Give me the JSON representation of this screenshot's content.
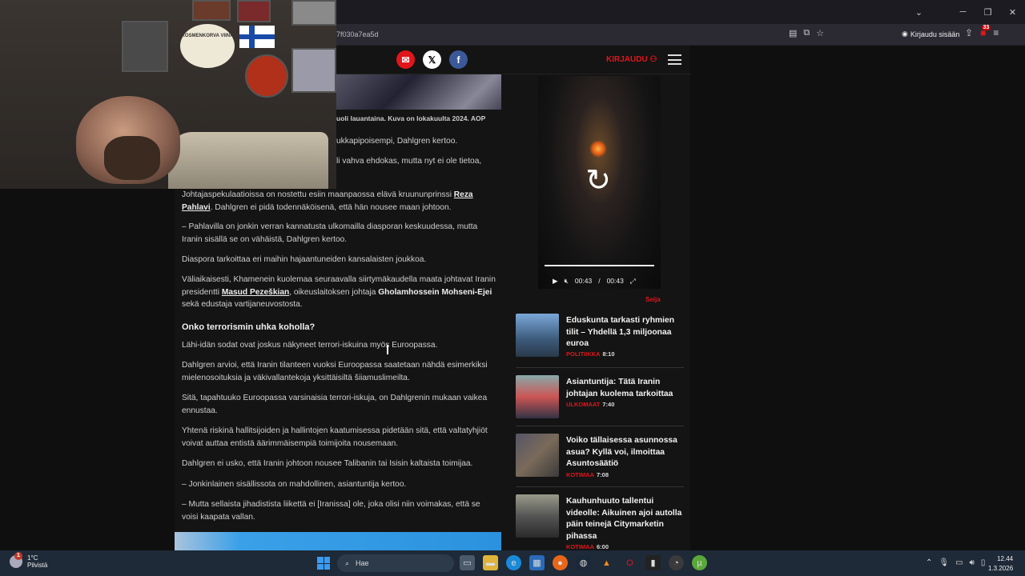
{
  "browser": {
    "url": "7f030a7ea5d",
    "signin_label": "Kirjaudu sisään",
    "notifications_count": "33"
  },
  "header": {
    "login_label": "KIRJAUDU"
  },
  "article": {
    "caption": "uoli lauantaina. Kuva on lokakuulta 2024. AOP",
    "partial_1": "ukkapipoisempi, Dahlgren kertoo.",
    "partial_2": "li vahva ehdokas, mutta nyt ei ole tietoa,",
    "p1_before": "Johtajaspekulaatioissa on nostettu esiin maanpaossa elävä kruununprinssi ",
    "p1_link": "Reza Pahlavi",
    "p1_after": ". Dahlgren ei pidä todennäköisenä, että hän nousee maan johtoon.",
    "p2": "– Pahlavilla on jonkin verran kannatusta ulkomailla diasporan keskuudessa, mutta Iranin sisällä se on vähäistä, Dahlgren kertoo.",
    "p3": "Diaspora tarkoittaa eri maihin hajaantuneiden kansalaisten joukkoa.",
    "p4_before": "Väliaikaisesti, Khamenein kuolemaa seuraavalla siirtymäkaudella maata johtavat Iranin presidentti ",
    "p4_link": "Masud Pezeškian",
    "p4_mid": ", oikeuslaitoksen johtaja ",
    "p4_bold": "Gholamhossein Mohseni-Ejei",
    "p4_after": " sekä edustaja vartijaneuvostosta.",
    "subheading": "Onko terrorismin uhka koholla?",
    "p5": "Lähi-idän sodat ovat joskus näkyneet terrori-iskuina myös Euroopassa.",
    "p6": "Dahlgren arvioi, että Iranin tilanteen vuoksi Euroopassa saatetaan nähdä esimerkiksi mielenosoituksia ja väkivallantekoja yksittäisiltä šiiamuslimeilta.",
    "p7": "Sitä, tapahtuuko Euroopassa varsinaisia terrori-iskuja, on Dahlgrenin mukaan vaikea ennustaa.",
    "p8": "Yhtenä riskinä hallitsijoiden ja hallintojen kaatumisessa pidetään sitä, että valtatyhjiöt voivat auttaa entistä äärimmäisempiä toimijoita nousemaan.",
    "p9": "Dahlgren ei usko, että Iranin johtoon nousee Talibanin tai Isisin kaltaista toimijaa.",
    "p10": "– Jonkinlainen sisällissota on mahdollinen, asiantuntija kertoo.",
    "p11": "– Mutta sellaista jihadistista liikettä ei [Iranissa] ole, joka olisi niin voimakas, että se voisi kaapata vallan."
  },
  "video": {
    "current_time": "00:43",
    "separator": "/",
    "duration": "00:43",
    "label": "Seija"
  },
  "news": [
    {
      "title": "Eduskunta tarkasti ryhmien tilit – Yhdellä 1,3 miljoonaa euroa",
      "category": "POLITIIKKA",
      "time": "8:10"
    },
    {
      "title": "Asiantuntija: Tätä Iranin johtajan kuolema tarkoittaa",
      "category": "ULKOMAAT",
      "time": "7:40"
    },
    {
      "title": "Voiko tällaisessa asunnossa asua? Kyllä voi, ilmoittaa Asuntosäätiö",
      "category": "KOTIMAA",
      "time": "7:08"
    },
    {
      "title": "Kauhunhuuto tallentui videolle: Aikuinen ajoi autolla päin teinejä Citymarketin pihassa",
      "category": "KOTIMAA",
      "time": "6:00"
    }
  ],
  "webcam": {
    "sign_text": "KOSMENKORVA VIINA"
  },
  "taskbar": {
    "temperature": "1°C",
    "weather": "Pilvistä",
    "weather_badge": "1",
    "search_label": "Hae",
    "time": "12.44",
    "date": "1.3.2026"
  },
  "colors": {
    "accent_red": "#e0161b",
    "page_bg": "#141414"
  }
}
